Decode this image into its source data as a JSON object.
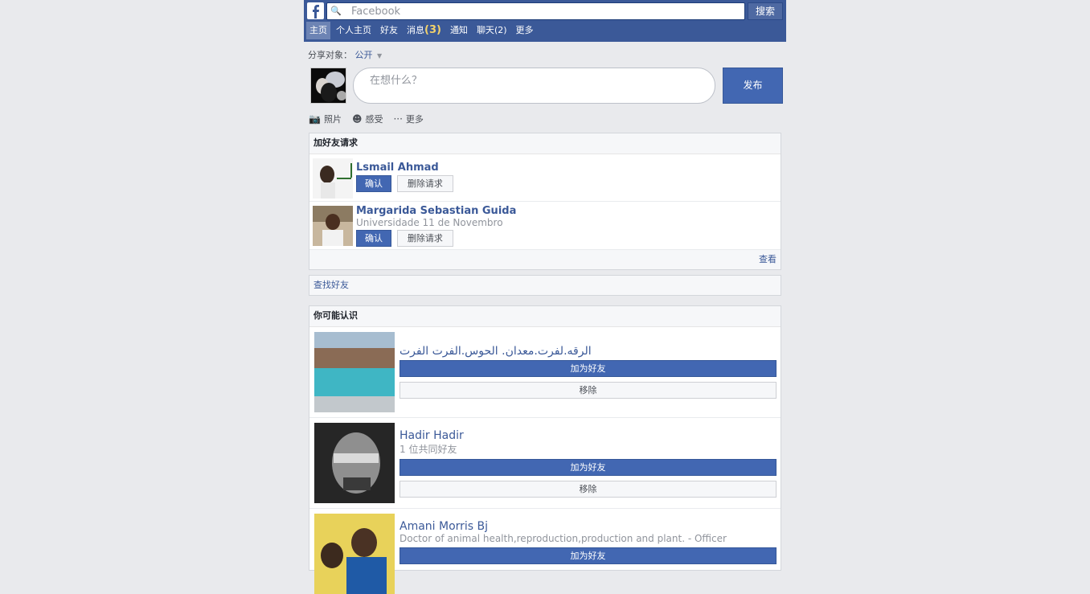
{
  "header": {
    "search_glyph": "🔍",
    "search_placeholder": "Facebook",
    "search_button": "搜索",
    "nav": [
      {
        "label": "主页",
        "count": ""
      },
      {
        "label": "个人主页",
        "count": ""
      },
      {
        "label": "好友",
        "count": ""
      },
      {
        "label": "消息",
        "count": "(3)"
      },
      {
        "label": "通知",
        "count": ""
      },
      {
        "label": "聊天",
        "count": "(2)"
      },
      {
        "label": "更多",
        "count": ""
      }
    ]
  },
  "publisher": {
    "audience_label": "分享对象：",
    "audience_value": "公开",
    "composer_placeholder": "在想什么？",
    "post_button": "发布",
    "tools": [
      {
        "icon": "camera-icon",
        "glyph": "📷",
        "label": "照片"
      },
      {
        "icon": "smile-icon",
        "glyph": "☻",
        "label": "感受"
      },
      {
        "icon": "more-icon",
        "glyph": "···",
        "label": "更多"
      }
    ]
  },
  "requests": {
    "title": "加好友请求",
    "confirm_label": "确认",
    "delete_label": "删除请求",
    "items": [
      {
        "name": "Lsmail Ahmad",
        "sub": ""
      },
      {
        "name": "Margarida Sebastian Guida",
        "sub": "Universidade 11 de Novembro"
      }
    ],
    "more_label": "查看"
  },
  "find_friends": {
    "label": "查找好友"
  },
  "suggestions": {
    "title": "你可能认识",
    "add_label": "加为好友",
    "remove_label": "移除",
    "items": [
      {
        "name": "الرقه.لفرت.معدان. الحوس.الفرت الفرت",
        "sub": ""
      },
      {
        "name": "Hadir Hadir",
        "sub": "1 位共同好友"
      },
      {
        "name": "Amani Morris Bj",
        "sub": "Doctor of animal health,reproduction,production and plant. - Officer"
      }
    ]
  },
  "colors": {
    "brand": "#3b5998",
    "button": "#4267b2",
    "background": "#e9eaed"
  }
}
